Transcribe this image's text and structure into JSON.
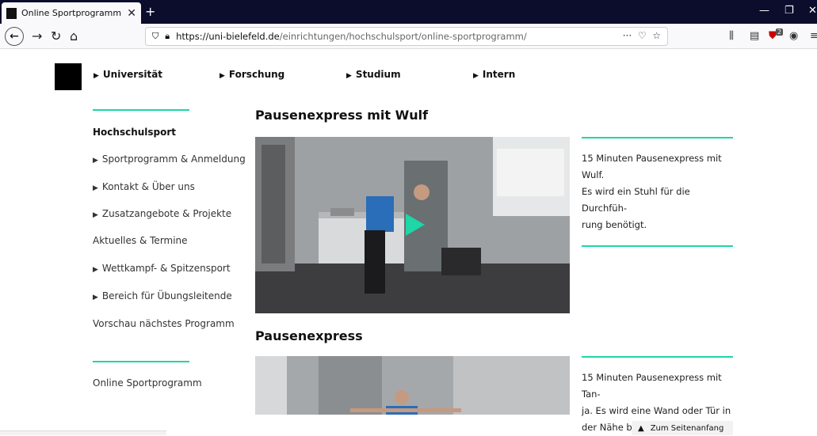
{
  "browser": {
    "tab_title": "Online Sportprogramm - Unive",
    "url_host": "https://uni-bielefeld.de",
    "url_path": "/einrichtungen/hochschulsport/online-sportprogramm/",
    "ext_badge": "2"
  },
  "mainnav": [
    "Universität",
    "Forschung",
    "Studium",
    "Intern"
  ],
  "sidebar": {
    "heading": "Hochschulsport",
    "items": [
      {
        "label": "Sportprogramm & Anmeldung",
        "arrow": true
      },
      {
        "label": "Kontakt & Über uns",
        "arrow": true
      },
      {
        "label": "Zusatzangebote & Projekte",
        "arrow": true
      },
      {
        "label": "Aktuelles & Termine",
        "arrow": false
      },
      {
        "label": "Wettkampf- & Spitzensport",
        "arrow": true
      },
      {
        "label": "Bereich für Übungsleitende",
        "arrow": true
      },
      {
        "label": "Vorschau nächstes Programm",
        "arrow": false
      }
    ],
    "footer_item": "Online Sportprogramm"
  },
  "videos": [
    {
      "title": "Pausenexpress mit Wulf",
      "desc_lines": [
        "15 Minuten Pausenexpress mit Wulf.",
        "Es wird ein Stuhl für die Durchfüh-",
        "rung benötigt."
      ]
    },
    {
      "title": "Pausenexpress",
      "desc_lines": [
        "15 Minuten Pausenexpress mit Tan-",
        "ja. Es wird eine Wand oder Tür in",
        "der Nähe benötigt."
      ]
    }
  ],
  "totop_label": "Zum Seitenanfang",
  "colors": {
    "accent": "#1ed6a6",
    "tabbar": "#0c0c2c"
  }
}
